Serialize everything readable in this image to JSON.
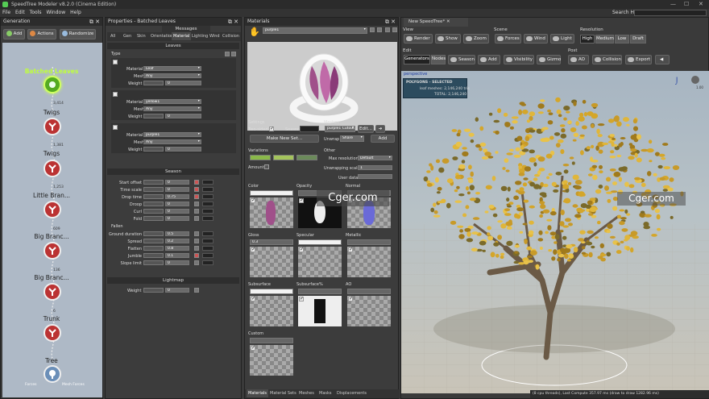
{
  "app": {
    "title": "SpeedTree Modeler v8.2.0 (Cinema Edition)",
    "search_help": "Search Help:"
  },
  "menu": [
    "File",
    "Edit",
    "Tools",
    "Window",
    "Help"
  ],
  "generation": {
    "title": "Generation",
    "buttons": [
      "Add",
      "Actions",
      "Randomize"
    ],
    "nodes": [
      {
        "label": "Batched Leaves",
        "count": "3,414"
      },
      {
        "label": "Twigs",
        "count": "1,381"
      },
      {
        "label": "Twigs",
        "count": "1,253"
      },
      {
        "label": "Little Bran...",
        "count": "609"
      },
      {
        "label": "Big Branc...",
        "count": "136"
      },
      {
        "label": "Big Branc...",
        "count": "6"
      },
      {
        "label": "Trunk",
        "count": ""
      },
      {
        "label": "Tree",
        "count": ""
      }
    ],
    "bottom_labels": [
      "Forces",
      "Mesh Forces"
    ]
  },
  "properties": {
    "title": "Properties - Batched Leaves",
    "messages": "Messages",
    "tabs": [
      "All",
      "Gen",
      "Skin",
      "Orientation",
      "Material",
      "Lighting",
      "Wind",
      "Collision"
    ],
    "leaves_section": "Leaves",
    "type_label": "Type",
    "entries": [
      {
        "material": "Leaf",
        "mesh": "Any",
        "weight": "0"
      },
      {
        "material": "yellow1",
        "mesh": "Any",
        "weight": "0"
      },
      {
        "material": "purple1",
        "mesh": "Any",
        "weight": "0"
      }
    ],
    "entry_labels": {
      "material": "Material",
      "mesh": "Mesh",
      "weight": "Weight"
    },
    "season_section": "Season",
    "season_rows": [
      {
        "label": "Start offset",
        "value": "0"
      },
      {
        "label": "Time scale",
        "value": "0"
      },
      {
        "label": "Drop time",
        "value": "0.75"
      },
      {
        "label": "Droop",
        "value": "0"
      },
      {
        "label": "Curl",
        "value": "0"
      },
      {
        "label": "Fold",
        "value": "0"
      }
    ],
    "fallen_label": "Fallen",
    "fallen_rows": [
      {
        "label": "Ground duration",
        "value": "0.5"
      },
      {
        "label": "Spread",
        "value": "0.2"
      },
      {
        "label": "Flatten",
        "value": "0.8"
      },
      {
        "label": "Jumble",
        "value": "0.1"
      },
      {
        "label": "Slope limit",
        "value": "0"
      }
    ],
    "lightmap_section": "Lightmap",
    "lightmap_weight_label": "Weight",
    "lightmap_weight": "0"
  },
  "materials": {
    "title": "Materials",
    "selected": "purple1",
    "settings_label": "Settings",
    "two_sided_label": "Two-sided",
    "season_label": "Season",
    "make_new_set": "Make New Set...",
    "meshes_label": "Meshes",
    "mesh_value": "purple1 Cutout",
    "edit_label": "Edit...",
    "unwrap_label": "Unwrap",
    "unwrap_value": "Share",
    "add_label": "Add",
    "variations_label": "Variations",
    "amount_label": "Amount",
    "other_label": "Other",
    "max_resolution_label": "Max resolution",
    "max_resolution_value": "Default",
    "unwrapping_scale_label": "Unwrapping scale",
    "unwrapping_scale_value": "1",
    "user_data_label": "User data",
    "maps": [
      "Color",
      "Opacity",
      "Normal",
      "Gloss",
      "Specular",
      "Metallic",
      "Subsurface",
      "Subsurface%",
      "AO",
      "Custom"
    ],
    "gloss_value": "0.3",
    "bottom_tabs": [
      "Materials",
      "Material Sets",
      "Meshes",
      "Masks",
      "Displacements"
    ],
    "colors": {
      "variation1": "#8ab84a",
      "variation2": "#a4c45c",
      "variation3": "#6b8a5a"
    }
  },
  "viewport": {
    "tab": "New SpeedTree*",
    "view_label": "View",
    "view_buttons": [
      "Render",
      "Show",
      "Zoom"
    ],
    "scene_label": "Scene",
    "scene_buttons": [
      "Forces",
      "Wind",
      "Light"
    ],
    "resolution_label": "Resolution",
    "resolution": [
      "High",
      "Medium",
      "Low",
      "Draft"
    ],
    "edit_label": "Edit",
    "edit_buttons": [
      "Generators",
      "Nodes",
      "Season",
      "Add",
      "Visibility",
      "Gizmo"
    ],
    "post_label": "Post",
    "post_buttons": [
      "AO",
      "Collision",
      "Export"
    ],
    "perspective": "perspective",
    "polygons_title": "POLYGONS - SELECTED",
    "leaf_meshes": "leaf meshes: 2,146,240 tris",
    "total": "TOTAL: 2,146,240",
    "scale_label": "1.00",
    "status": "(8 cpu threads), Last Compute 357.97 ms (draw to draw 1282.96 ms)",
    "watermark": "Cger.com"
  }
}
